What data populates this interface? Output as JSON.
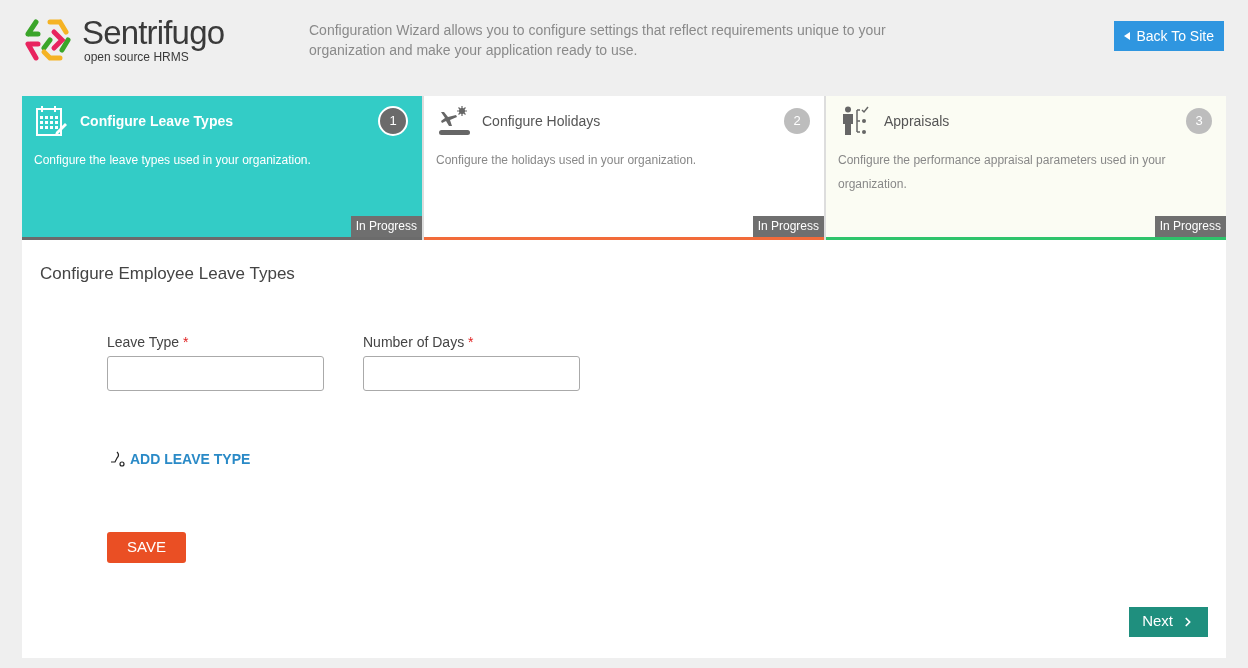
{
  "header": {
    "logo_name": "Sentrifugo",
    "logo_tagline": "open source HRMS",
    "intro": "Configuration Wizard allows you to configure settings that reflect requirements unique to your organization and make your application ready to use.",
    "back_button": "Back To Site"
  },
  "steps": [
    {
      "kind": "calendar",
      "title": "Configure Leave Types",
      "number": "1",
      "description": "Configure the leave types used in your organization.",
      "status": "In Progress",
      "selected": true,
      "hovered": false,
      "color": "#6b6b6b"
    },
    {
      "kind": "holiday",
      "title": "Configure Holidays",
      "number": "2",
      "description": "Configure the holidays used in your organization.",
      "status": "In Progress",
      "selected": false,
      "hovered": false,
      "color": "#f26b3a"
    },
    {
      "kind": "appraisal",
      "title": "Appraisals",
      "number": "3",
      "description": "Configure the performance appraisal parameters used in your organization.",
      "status": "In Progress",
      "selected": false,
      "hovered": true,
      "color": "#2ec36b"
    }
  ],
  "form": {
    "heading": "Configure Employee Leave Types",
    "fields": [
      {
        "label": "Leave Type",
        "required_mark": "*"
      },
      {
        "label": "Number of Days",
        "required_mark": "*"
      }
    ],
    "add_link": "ADD LEAVE TYPE",
    "save_button": "SAVE",
    "next_button": "Next"
  }
}
